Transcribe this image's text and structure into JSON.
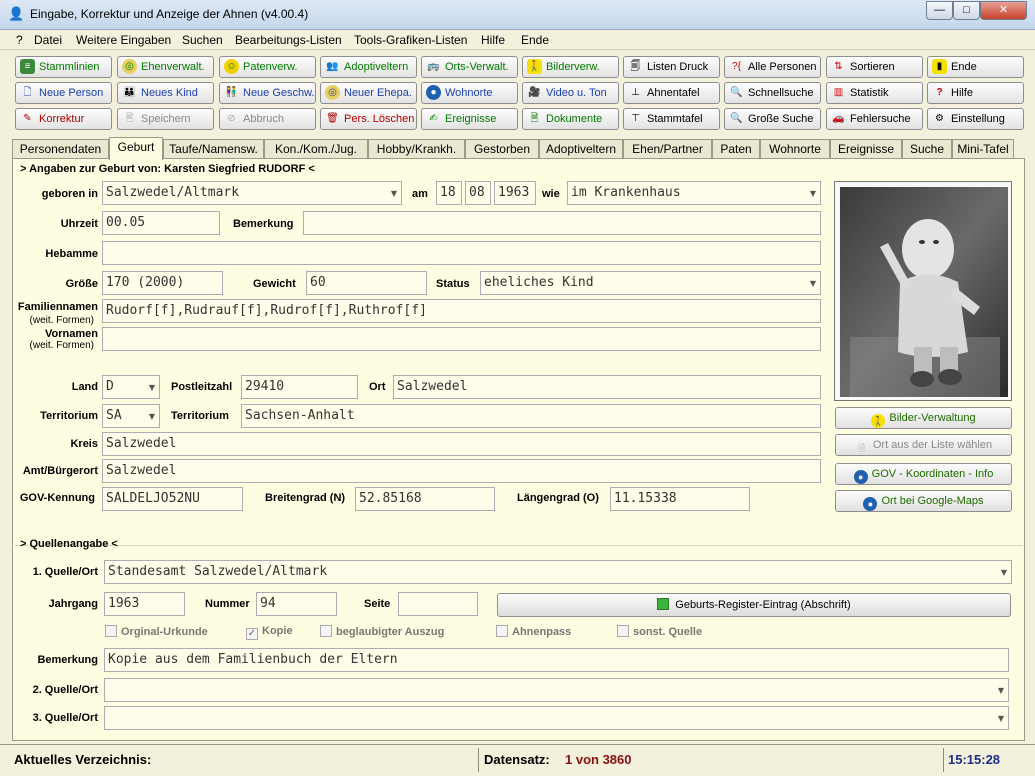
{
  "window": {
    "title": "Eingabe, Korrektur und Anzeige der Ahnen (v4.00.4)",
    "min": "—",
    "max": "□",
    "close": "✕"
  },
  "menu": [
    "?",
    "Datei",
    "Weitere Eingaben",
    "Suchen",
    "Bearbeitungs-Listen",
    "Tools-Grafiken-Listen",
    "Hilfe",
    "Ende"
  ],
  "toolbar": {
    "row1": [
      "Stammlinien",
      "Ehenverwalt.",
      "Patenverw.",
      "Adoptiveltern",
      "Orts-Verwalt.",
      "Bilderverw.",
      "Listen Druck",
      "Alle Personen",
      "Sortieren",
      "Ende"
    ],
    "row2": [
      "Neue Person",
      "Neues Kind",
      "Neue Geschw.",
      "Neuer Ehepa.",
      "Wohnorte",
      "Video u. Ton",
      "Ahnentafel",
      "Schnellsuche",
      "Statistik",
      "Hilfe"
    ],
    "row3": [
      "Korrektur",
      "Speichern",
      "Abbruch",
      "Pers. Löschen",
      "Ereignisse",
      "Dokumente",
      "Stammtafel",
      "Große Suche",
      "Fehlersuche",
      "Einstellung"
    ]
  },
  "tabs": [
    "Personendaten",
    "Geburt",
    "Taufe/Namensw.",
    "Kon./Kom./Jug.",
    "Hobby/Krankh.",
    "Gestorben",
    "Adoptiveltern",
    "Ehen/Partner",
    "Paten",
    "Wohnorte",
    "Ereignisse",
    "Suche",
    "Mini-Tafel"
  ],
  "birth": {
    "header": "> Angaben zur Geburt von:  Karsten Siegfried RUDORF <",
    "geboren_in_label": "geboren in",
    "geboren_in": "Salzwedel/Altmark",
    "am_label": "am",
    "day": "18",
    "month": "08",
    "year": "1963",
    "wie_label": "wie",
    "wie": "im Krankenhaus",
    "uhrzeit_label": "Uhrzeit",
    "uhrzeit": "00.05",
    "bemerkung_label": "Bemerkung",
    "bemerkung": "",
    "hebamme_label": "Hebamme",
    "hebamme": "",
    "groesse_label": "Größe",
    "groesse": "170 (2000)",
    "gewicht_label": "Gewicht",
    "gewicht": "60",
    "status_label": "Status",
    "status": "eheliches Kind",
    "familiennamen_label": "Familiennamen",
    "familiennamen_sub": "(weit. Formen)",
    "familiennamen": "Rudorf[f],Rudrauf[f],Rudrof[f],Ruthrof[f]",
    "vornamen_label": "Vornamen",
    "vornamen_sub": "(weit. Formen)",
    "vornamen": "",
    "land_label": "Land",
    "land": "D",
    "plz_label": "Postleitzahl",
    "plz": "29410",
    "ort_label": "Ort",
    "ort": "Salzwedel",
    "territorium_label": "Territorium",
    "territorium_code": "SA",
    "territorium2_label": "Territorium",
    "territorium": "Sachsen-Anhalt",
    "kreis_label": "Kreis",
    "kreis": "Salzwedel",
    "amt_label": "Amt/Bürgerort",
    "amt": "Salzwedel",
    "gov_label": "GOV-Kennung",
    "gov": "SALDELJO52NU",
    "breite_label": "Breitengrad (N)",
    "breite": "52.85168",
    "laenge_label": "Längengrad (O)",
    "laenge": "11.15338"
  },
  "side_buttons": [
    "Bilder-Verwaltung",
    "Ort aus der Liste wählen",
    "GOV - Koordinaten - Info",
    "Ort bei Google-Maps"
  ],
  "source": {
    "header": "> Quellenangabe <",
    "quelle1_label": "1. Quelle/Ort",
    "quelle1": "Standesamt Salzwedel/Altmark",
    "jahrgang_label": "Jahrgang",
    "jahrgang": "1963",
    "nummer_label": "Nummer",
    "nummer": "94",
    "seite_label": "Seite",
    "seite": "",
    "register_button": "Geburts-Register-Eintrag (Abschrift)",
    "checks": [
      {
        "label": "Orginal-Urkunde",
        "checked": false
      },
      {
        "label": "Kopie",
        "checked": true
      },
      {
        "label": "beglaubigter Auszug",
        "checked": false
      },
      {
        "label": "Ahnenpass",
        "checked": false
      },
      {
        "label": "sonst. Quelle",
        "checked": false
      }
    ],
    "bemerkung_label": "Bemerkung",
    "bemerkung": "Kopie aus dem Familienbuch der Eltern",
    "quelle2_label": "2. Quelle/Ort",
    "quelle2": "",
    "quelle3_label": "3. Quelle/Ort",
    "quelle3": ""
  },
  "status": {
    "verzeichnis_label": "Aktuelles Verzeichnis:",
    "datensatz_label": "Datensatz:",
    "datensatz": "1 von 3860",
    "time": "15:15:28"
  }
}
